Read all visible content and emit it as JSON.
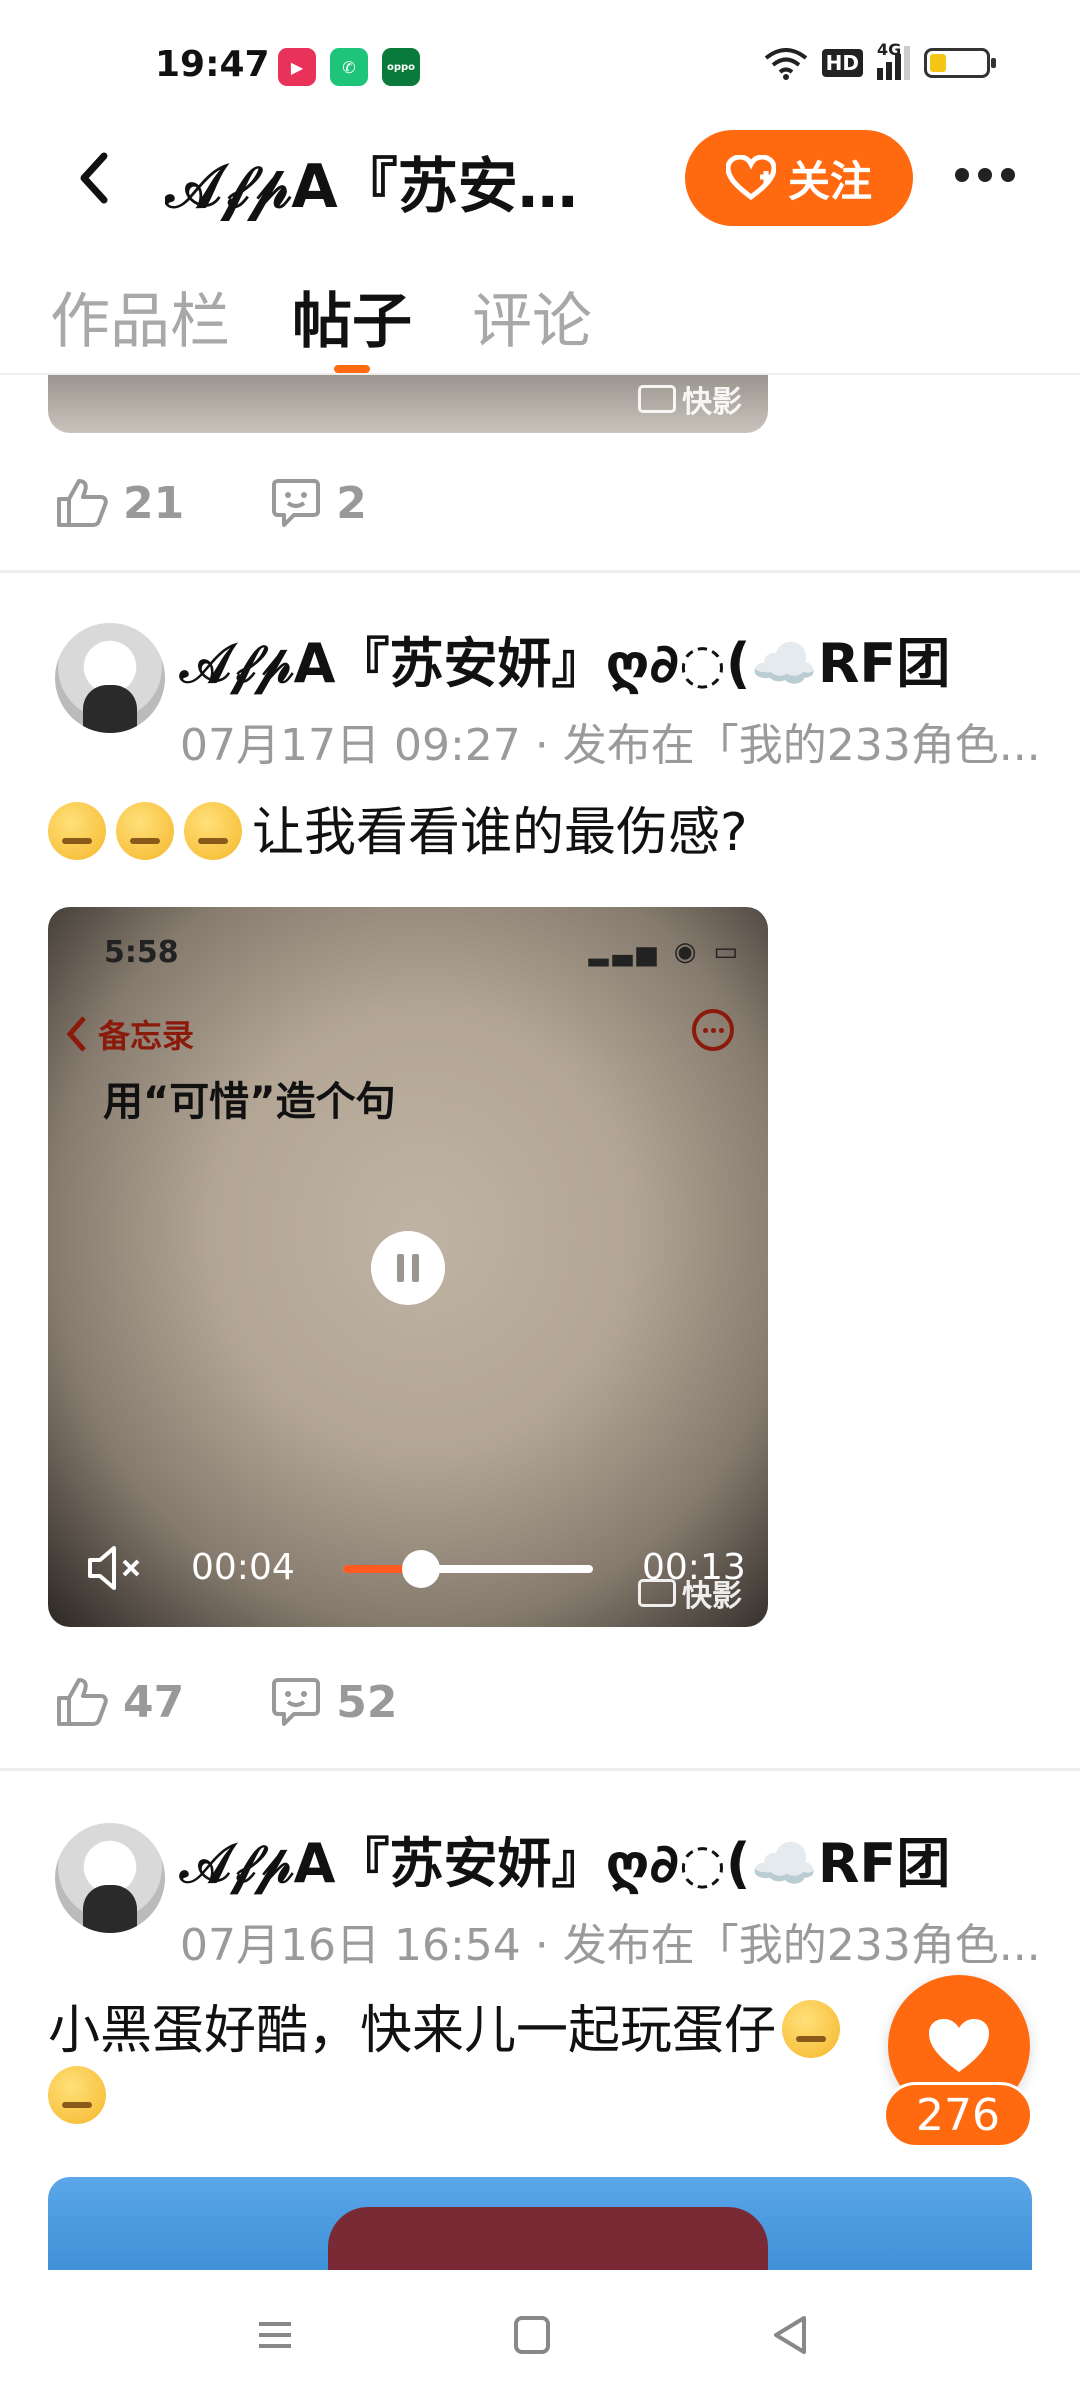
{
  "status_bar": {
    "time": "19:47",
    "network": "4G",
    "hd": "HD"
  },
  "header": {
    "title": "𝒜𝒻𝓅A『苏安妍...",
    "follow_label": "关注"
  },
  "tabs": [
    {
      "label": "作品栏"
    },
    {
      "label": "帖子"
    },
    {
      "label": "评论"
    }
  ],
  "video_watermark": "快影",
  "posts": [
    {
      "likes": "21",
      "comments": "2"
    },
    {
      "author": "𝒜𝒻𝓅A『苏安妍』ღ∂◌(☁️RF团",
      "meta": "07月17日 09:27 · 发布在「我的233角色...",
      "text": "让我看看谁的最伤感?",
      "video": {
        "inner_time": "5:58",
        "inner_back": "备忘录",
        "inner_note": "用“可惜”造个句",
        "current_time": "00:04",
        "duration": "00:13",
        "progress": 0.31
      },
      "likes": "47",
      "comments": "52"
    },
    {
      "author": "𝒜𝒻𝓅A『苏安妍』ღ∂◌(☁️RF团",
      "meta": "07月16日 16:54 · 发布在「我的233角色...",
      "text": "小黑蛋好酷，快来儿一起玩蛋仔"
    }
  ],
  "floating_like_count": "276",
  "colors": {
    "accent": "#ff6a10"
  }
}
